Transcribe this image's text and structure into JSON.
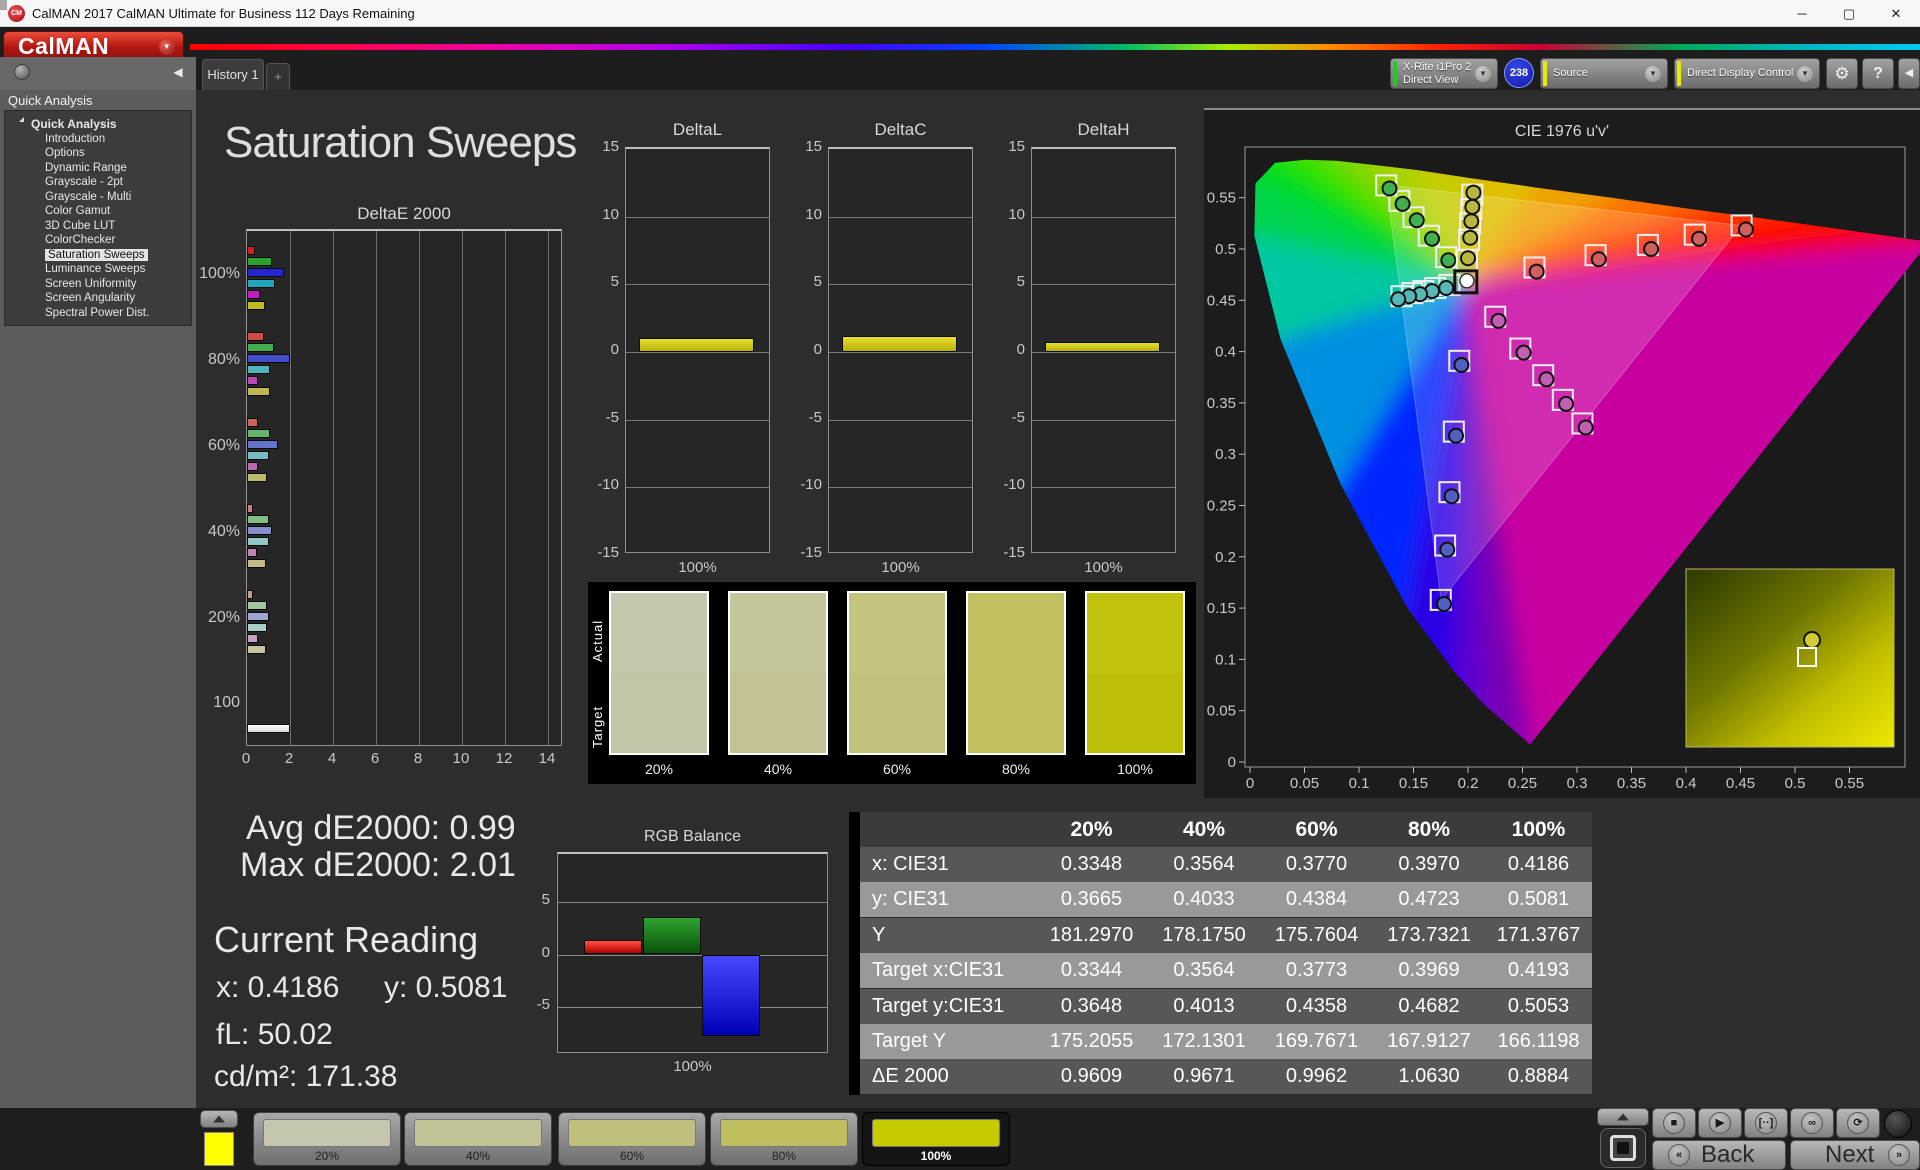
{
  "window": {
    "title": "CalMAN 2017 CalMAN Ultimate for Business 112 Days Remaining",
    "minimize": "─",
    "maximize": "▢",
    "close": "✕"
  },
  "brand": {
    "logo_text": "CalMAN",
    "caret": "▼"
  },
  "tabs": {
    "active": "History 1",
    "add_label": "+"
  },
  "toolbar": {
    "meter_line1": "X-Rite i1Pro 2",
    "meter_line2": "Direct View",
    "badge": "238",
    "source_label": "Source",
    "display_control_label": "Direct Display Control",
    "gear": "⚙",
    "help": "?",
    "collapse": "◀"
  },
  "sidebar": {
    "header": "Quick Analysis",
    "items": [
      {
        "label": "Quick Analysis",
        "root": true,
        "selected": false
      },
      {
        "label": "Introduction",
        "selected": false
      },
      {
        "label": "Options",
        "selected": false
      },
      {
        "label": "Dynamic Range",
        "selected": false
      },
      {
        "label": "Grayscale - 2pt",
        "selected": false
      },
      {
        "label": "Grayscale - Multi",
        "selected": false
      },
      {
        "label": "Color Gamut",
        "selected": false
      },
      {
        "label": "3D Cube LUT",
        "selected": false
      },
      {
        "label": "ColorChecker",
        "selected": false
      },
      {
        "label": "Saturation Sweeps",
        "selected": true
      },
      {
        "label": "Luminance Sweeps",
        "selected": false
      },
      {
        "label": "Screen Uniformity",
        "selected": false
      },
      {
        "label": "Screen Angularity",
        "selected": false
      },
      {
        "label": "Spectral Power Dist.",
        "selected": false
      }
    ]
  },
  "main": {
    "title": "Saturation Sweeps"
  },
  "readings": {
    "avg": "Avg dE2000: 0.99",
    "max": "Max dE2000: 2.01",
    "current_label": "Current Reading",
    "x": "x: 0.4186",
    "y": "y: 0.5081",
    "fl": "fL: 50.02",
    "cdm2": "cd/m²: 171.38"
  },
  "swatch_strip": {
    "row_labels": [
      "Actual",
      "Target"
    ],
    "swatches": [
      {
        "label": "20%",
        "actual": "#c6c7ae",
        "target": "#c3c4a8"
      },
      {
        "label": "40%",
        "actual": "#c5c59b",
        "target": "#c2c295"
      },
      {
        "label": "60%",
        "actual": "#c4c481",
        "target": "#c1c17c"
      },
      {
        "label": "80%",
        "actual": "#c2c162",
        "target": "#bfbf5e"
      },
      {
        "label": "100%",
        "actual": "#c1c20b",
        "target": "#bdbe07"
      }
    ]
  },
  "table": {
    "headers": [
      "",
      "20%",
      "40%",
      "60%",
      "80%",
      "100%"
    ],
    "rows": [
      {
        "label": "x: CIE31",
        "values": [
          "0.3348",
          "0.3564",
          "0.3770",
          "0.3970",
          "0.4186"
        ],
        "shade": "dark"
      },
      {
        "label": "y: CIE31",
        "values": [
          "0.3665",
          "0.4033",
          "0.4384",
          "0.4723",
          "0.5081"
        ],
        "shade": "light"
      },
      {
        "label": "Y",
        "values": [
          "181.2970",
          "178.1750",
          "175.7604",
          "173.7321",
          "171.3767"
        ],
        "shade": "dark"
      },
      {
        "label": "Target x:CIE31",
        "values": [
          "0.3344",
          "0.3564",
          "0.3773",
          "0.3969",
          "0.4193"
        ],
        "shade": "light"
      },
      {
        "label": "Target y:CIE31",
        "values": [
          "0.3648",
          "0.4013",
          "0.4358",
          "0.4682",
          "0.5053"
        ],
        "shade": "dark"
      },
      {
        "label": "Target Y",
        "values": [
          "175.2055",
          "172.1301",
          "169.7671",
          "167.9127",
          "166.1198"
        ],
        "shade": "light"
      },
      {
        "label": "ΔE 2000",
        "values": [
          "0.9609",
          "0.9671",
          "0.9962",
          "1.0630",
          "0.8884"
        ],
        "shade": "dark"
      }
    ]
  },
  "bottom_bar": {
    "palette_color": "#ffff00",
    "swatch_buttons": [
      {
        "label": "20%",
        "color": "#c5c6ad",
        "selected": false
      },
      {
        "label": "40%",
        "color": "#c2c297",
        "selected": false
      },
      {
        "label": "60%",
        "color": "#c0c07c",
        "selected": false
      },
      {
        "label": "80%",
        "color": "#bebe5e",
        "selected": false
      },
      {
        "label": "100%",
        "color": "#c6ca00",
        "selected": true
      }
    ],
    "transport": [
      "■",
      "▶",
      "[··]",
      "∞",
      "⟳"
    ],
    "back_label": "Back",
    "next_label": "Next",
    "back_chevrons": "«",
    "next_chevrons": "»"
  },
  "chart_data": [
    {
      "id": "deltae2000",
      "type": "bar",
      "orientation": "horizontal",
      "title": "DeltaE 2000",
      "xlim": [
        0,
        14
      ],
      "x_ticks": [
        "0",
        "2",
        "4",
        "6",
        "8",
        "10",
        "12",
        "14"
      ],
      "series_names": [
        "Red",
        "Green",
        "Blue",
        "Cyan",
        "Magenta",
        "Yellow"
      ],
      "groups": [
        {
          "label": "100%",
          "values": [
            0.35,
            1.15,
            1.7,
            1.3,
            0.6,
            0.85
          ],
          "colors": [
            "#cf201d",
            "#27a32e",
            "#2427cf",
            "#1fa8bc",
            "#bf1dbf",
            "#bfbc22"
          ]
        },
        {
          "label": "80%",
          "values": [
            0.8,
            1.25,
            2.0,
            1.05,
            0.5,
            1.05
          ],
          "colors": [
            "#cf4a44",
            "#46ad4e",
            "#444dc9",
            "#4db5bd",
            "#b949b3",
            "#bcb74e"
          ]
        },
        {
          "label": "60%",
          "values": [
            0.5,
            1.05,
            1.45,
            1.0,
            0.5,
            0.95
          ],
          "colors": [
            "#c9645e",
            "#63b569",
            "#6472c9",
            "#72bec2",
            "#bd68b7",
            "#bfb96a"
          ]
        },
        {
          "label": "40%",
          "values": [
            0.3,
            1.0,
            1.15,
            1.0,
            0.45,
            0.9
          ],
          "colors": [
            "#c48078",
            "#83bd87",
            "#8790cc",
            "#90c6c4",
            "#bd86b7",
            "#c2bb85"
          ]
        },
        {
          "label": "20%",
          "values": [
            0.3,
            0.95,
            1.0,
            0.95,
            0.5,
            0.9
          ],
          "colors": [
            "#c69992",
            "#a0c6a0",
            "#a0a6d2",
            "#a6cfca",
            "#c6a0bd",
            "#c9c49c"
          ]
        },
        {
          "label": "100",
          "values": [
            2.0
          ],
          "colors": [
            "#f5f5f2"
          ]
        }
      ]
    },
    {
      "id": "deltaL",
      "type": "bar",
      "title": "DeltaL",
      "ylim": [
        -15,
        15
      ],
      "y_ticks": [
        "15",
        "10",
        "5",
        "0",
        "-5",
        "-10",
        "-15"
      ],
      "categories": [
        "100%"
      ],
      "values": [
        1.0
      ],
      "color": "#cfc613"
    },
    {
      "id": "deltaC",
      "type": "bar",
      "title": "DeltaC",
      "ylim": [
        -15,
        15
      ],
      "y_ticks": [
        "15",
        "10",
        "5",
        "0",
        "-5",
        "-10",
        "-15"
      ],
      "categories": [
        "100%"
      ],
      "values": [
        1.2
      ],
      "color": "#cfc613"
    },
    {
      "id": "deltaH",
      "type": "bar",
      "title": "DeltaH",
      "ylim": [
        -15,
        15
      ],
      "y_ticks": [
        "15",
        "10",
        "5",
        "0",
        "-5",
        "-10",
        "-15"
      ],
      "categories": [
        "100%"
      ],
      "values": [
        0.75
      ],
      "color": "#cfc613"
    },
    {
      "id": "rgb_balance",
      "type": "bar",
      "title": "RGB Balance",
      "ylim": [
        -9.5,
        9.5
      ],
      "y_ticks": [
        "5",
        "0",
        "-5"
      ],
      "xlabel": "100%",
      "categories": [
        "Red",
        "Green",
        "Blue"
      ],
      "values": [
        1.4,
        3.6,
        -7.8
      ],
      "colors": [
        "#e02020",
        "#1e7d1e",
        "#1515e8"
      ]
    },
    {
      "id": "cie1976",
      "type": "scatter",
      "title": "CIE 1976 u'v'",
      "x_ticks": [
        "0",
        "0.05",
        "0.1",
        "0.15",
        "0.2",
        "0.25",
        "0.3",
        "0.35",
        "0.4",
        "0.45",
        "0.5",
        "0.55"
      ],
      "y_ticks": [
        "0",
        "0.05",
        "0.1",
        "0.15",
        "0.2",
        "0.25",
        "0.3",
        "0.35",
        "0.4",
        "0.45",
        "0.5",
        "0.55"
      ],
      "white_point": {
        "target": [
          0.198,
          0.468
        ],
        "measured": [
          0.199,
          0.469
        ]
      },
      "gamut_triangle": [
        [
          0.4507,
          0.5229
        ],
        [
          0.125,
          0.5625
        ],
        [
          0.1754,
          0.1579
        ]
      ],
      "sweeps": [
        {
          "name": "red",
          "dot": "#d06060",
          "targets": [
            [
              0.261,
              0.482
            ],
            [
              0.317,
              0.494
            ],
            [
              0.365,
              0.504
            ],
            [
              0.408,
              0.514
            ],
            [
              0.451,
              0.523
            ]
          ],
          "measured": [
            [
              0.263,
              0.478
            ],
            [
              0.32,
              0.49
            ],
            [
              0.368,
              0.5
            ],
            [
              0.412,
              0.51
            ],
            [
              0.455,
              0.519
            ]
          ]
        },
        {
          "name": "green",
          "dot": "#40b050",
          "targets": [
            [
              0.18,
              0.492
            ],
            [
              0.164,
              0.513
            ],
            [
              0.15,
              0.531
            ],
            [
              0.137,
              0.547
            ],
            [
              0.125,
              0.562
            ]
          ],
          "measured": [
            [
              0.182,
              0.489
            ],
            [
              0.167,
              0.51
            ],
            [
              0.153,
              0.528
            ],
            [
              0.14,
              0.544
            ],
            [
              0.128,
              0.559
            ]
          ]
        },
        {
          "name": "blue",
          "dot": "#5060c0",
          "targets": [
            [
              0.192,
              0.391
            ],
            [
              0.187,
              0.322
            ],
            [
              0.183,
              0.263
            ],
            [
              0.179,
              0.211
            ],
            [
              0.175,
              0.158
            ]
          ],
          "measured": [
            [
              0.194,
              0.387
            ],
            [
              0.189,
              0.318
            ],
            [
              0.185,
              0.259
            ],
            [
              0.181,
              0.207
            ],
            [
              0.178,
              0.154
            ]
          ]
        },
        {
          "name": "cyan",
          "dot": "#58b8b8",
          "targets": [
            [
              0.183,
              0.465
            ],
            [
              0.17,
              0.462
            ],
            [
              0.159,
              0.459
            ],
            [
              0.149,
              0.457
            ],
            [
              0.139,
              0.454
            ]
          ],
          "measured": [
            [
              0.18,
              0.462
            ],
            [
              0.167,
              0.459
            ],
            [
              0.156,
              0.456
            ],
            [
              0.146,
              0.454
            ],
            [
              0.136,
              0.451
            ]
          ]
        },
        {
          "name": "magenta",
          "dot": "#c060b0",
          "targets": [
            [
              0.225,
              0.434
            ],
            [
              0.248,
              0.403
            ],
            [
              0.269,
              0.377
            ],
            [
              0.287,
              0.353
            ],
            [
              0.305,
              0.33
            ]
          ],
          "measured": [
            [
              0.228,
              0.43
            ],
            [
              0.251,
              0.399
            ],
            [
              0.272,
              0.373
            ],
            [
              0.29,
              0.349
            ],
            [
              0.308,
              0.326
            ]
          ]
        },
        {
          "name": "yellow",
          "dot": "#b8b840",
          "targets": [
            [
              0.199,
              0.489
            ],
            [
              0.201,
              0.509
            ],
            [
              0.202,
              0.525
            ],
            [
              0.203,
              0.539
            ],
            [
              0.204,
              0.553
            ]
          ],
          "measured": [
            [
              0.2,
              0.491
            ],
            [
              0.202,
              0.511
            ],
            [
              0.203,
              0.527
            ],
            [
              0.204,
              0.541
            ],
            [
              0.205,
              0.555
            ]
          ]
        }
      ],
      "locus": [
        [
          0.257,
          0.017,
          "#7a00b4"
        ],
        [
          0.216,
          0.055,
          "#5a00d2"
        ],
        [
          0.188,
          0.087,
          "#2a00e6"
        ],
        [
          0.144,
          0.151,
          "#0028ff"
        ],
        [
          0.083,
          0.271,
          "#0090e0"
        ],
        [
          0.028,
          0.412,
          "#00c8a0"
        ],
        [
          0.004,
          0.513,
          "#00d450"
        ],
        [
          0.005,
          0.564,
          "#00dc20"
        ],
        [
          0.023,
          0.584,
          "#20e400"
        ],
        [
          0.05,
          0.587,
          "#50e000"
        ],
        [
          0.079,
          0.586,
          "#80d800"
        ],
        [
          0.113,
          0.582,
          "#a8d400"
        ],
        [
          0.153,
          0.577,
          "#c8cc00"
        ],
        [
          0.203,
          0.569,
          "#e0c000"
        ],
        [
          0.262,
          0.56,
          "#f0a000"
        ],
        [
          0.332,
          0.55,
          "#ff7000"
        ],
        [
          0.404,
          0.539,
          "#ff3800"
        ],
        [
          0.469,
          0.53,
          "#ff1000"
        ],
        [
          0.557,
          0.517,
          "#f40000"
        ],
        [
          0.623,
          0.507,
          "#e80000"
        ]
      ],
      "magenta_line_color": "#c800a0"
    }
  ]
}
